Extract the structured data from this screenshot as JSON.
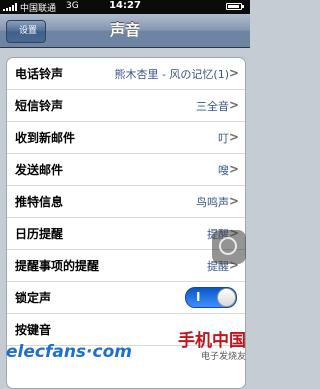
{
  "statusbar": {
    "carrier": "中国联通",
    "network": "3G",
    "time": "14:27"
  },
  "navbar": {
    "back_label": "设置",
    "title": "声音"
  },
  "rows": [
    {
      "label": "电话铃声",
      "value": "熊木杏里 - 风の记忆(1)",
      "type": "disclosure"
    },
    {
      "label": "短信铃声",
      "value": "三全音",
      "type": "disclosure"
    },
    {
      "label": "收到新邮件",
      "value": "叮",
      "type": "disclosure"
    },
    {
      "label": "发送邮件",
      "value": "嗖",
      "type": "disclosure"
    },
    {
      "label": "推特信息",
      "value": "鸟鸣声",
      "type": "disclosure"
    },
    {
      "label": "日历提醒",
      "value": "提醒",
      "type": "disclosure"
    },
    {
      "label": "提醒事项的提醒",
      "value": "提醒",
      "type": "disclosure"
    },
    {
      "label": "锁定声",
      "value": "I",
      "type": "toggle"
    },
    {
      "label": "按键音",
      "value": "",
      "type": "toggle"
    }
  ],
  "watermarks": {
    "left": "elecfans·com",
    "right": "手机中国",
    "right_sub": "电子发烧友"
  }
}
